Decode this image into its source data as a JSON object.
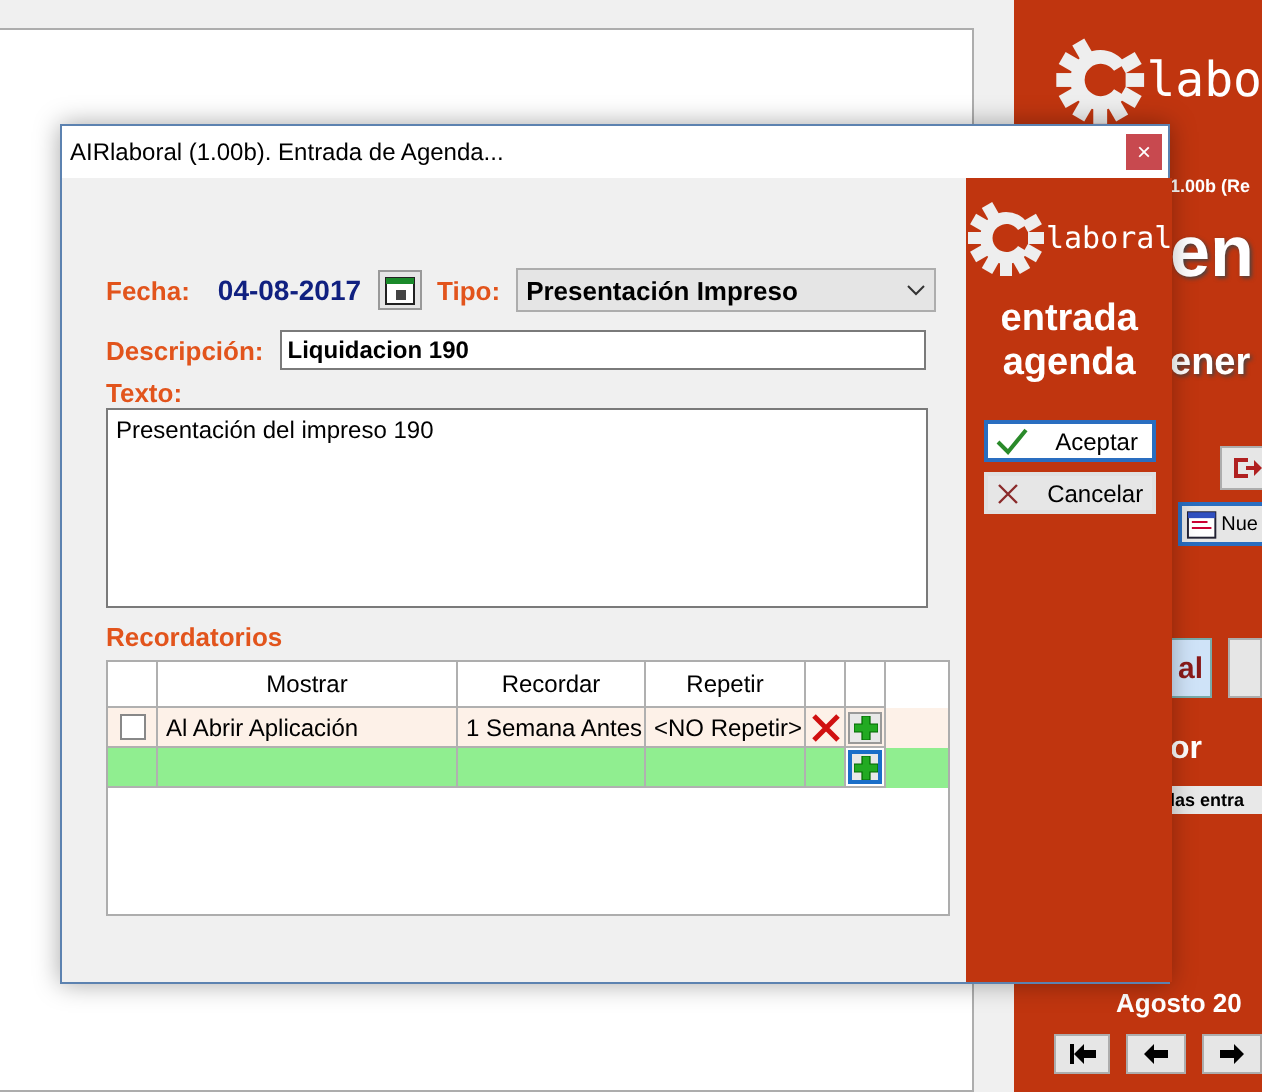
{
  "background": {
    "logo_text": "labo",
    "version": "1.00b (Re",
    "heading_1": "en",
    "heading_2": "ener",
    "new_button": "Nue",
    "tab_button": "al",
    "label": "or",
    "filter_bar": "las entra",
    "calendar_month": "Agosto 20"
  },
  "dialog": {
    "title": "AIRlaboral (1.00b). Entrada de Agenda...",
    "close": "×",
    "side": {
      "logo_text": "laboral",
      "heading": [
        "entrada",
        "agenda"
      ],
      "buttons": [
        {
          "kind": "accept",
          "label": "Aceptar",
          "selected": true
        },
        {
          "kind": "cancel",
          "label": "Cancelar",
          "selected": false
        }
      ]
    },
    "fecha_label": "Fecha:",
    "fecha": "04-08-2017",
    "tipo_label": "Tipo:",
    "tipo": "Presentación Impreso",
    "descripcion_label": "Descripción:",
    "descripcion": "Liquidacion 190",
    "texto_label": "Texto:",
    "texto": "Presentación del impreso 190",
    "reminders": {
      "title": "Recordatorios",
      "columns": [
        "Mostrar",
        "Recordar",
        "Repetir"
      ],
      "rows": [
        {
          "checked": false,
          "cells": [
            "Al Abrir Aplicación",
            "1 Semana Antes",
            "<NO Repetir>"
          ]
        }
      ]
    }
  }
}
